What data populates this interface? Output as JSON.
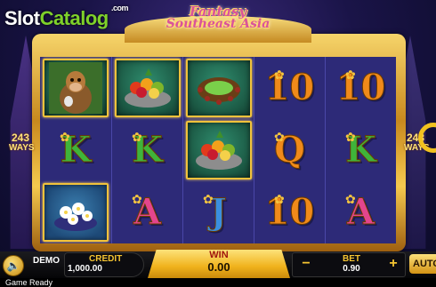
{
  "branding": {
    "logo_slot": "Slot",
    "logo_catalog": "Catalog",
    "logo_com": ".com"
  },
  "title": {
    "line1": "Fantasy",
    "line2": "Southeast Asia"
  },
  "ways": {
    "number": "243",
    "label": "WAYS"
  },
  "reels": [
    [
      {
        "type": "image",
        "icon": "monkey-icon"
      },
      {
        "type": "letter",
        "text": "K",
        "color": "green"
      },
      {
        "type": "image",
        "icon": "flower-plate-icon"
      }
    ],
    [
      {
        "type": "image",
        "icon": "fruit-basket-icon"
      },
      {
        "type": "letter",
        "text": "K",
        "color": "green"
      },
      {
        "type": "letter",
        "text": "A",
        "color": "pink"
      }
    ],
    [
      {
        "type": "image",
        "icon": "bead-bowl-icon"
      },
      {
        "type": "image",
        "icon": "fruit-basket-icon"
      },
      {
        "type": "letter",
        "text": "J",
        "color": "blue"
      }
    ],
    [
      {
        "type": "letter",
        "text": "10",
        "color": "orange"
      },
      {
        "type": "letter",
        "text": "Q",
        "color": "orange"
      },
      {
        "type": "letter",
        "text": "10",
        "color": "orange"
      }
    ],
    [
      {
        "type": "letter",
        "text": "10",
        "color": "orange"
      },
      {
        "type": "letter",
        "text": "K",
        "color": "green"
      },
      {
        "type": "letter",
        "text": "A",
        "color": "pink"
      }
    ]
  ],
  "controls": {
    "demo_label": "DEMO",
    "credit_label": "CREDIT",
    "credit_value": "1,000.00",
    "win_label": "WIN",
    "win_value": "0.00",
    "bet_label": "BET",
    "bet_value": "0.90",
    "minus": "−",
    "plus": "+",
    "auto_label": "AUTO"
  },
  "status": {
    "text": "Game Ready"
  },
  "colors": {
    "frame_gold": "#f2c23b",
    "reel_bg": "#2d2a78",
    "logo_green": "#7ed12a"
  }
}
